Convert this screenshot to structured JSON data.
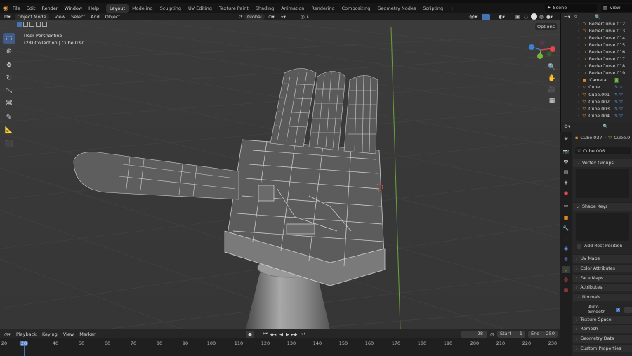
{
  "menubar": {
    "app_menu": [
      "File",
      "Edit",
      "Render",
      "Window",
      "Help"
    ],
    "workspaces": [
      "Layout",
      "Modeling",
      "Sculpting",
      "UV Editing",
      "Texture Paint",
      "Shading",
      "Animation",
      "Rendering",
      "Compositing",
      "Geometry Nodes",
      "Scripting"
    ],
    "active_workspace": "Layout",
    "add_tab": "+",
    "scene_label": "Scene",
    "view_layer_label": "View"
  },
  "viewport_header": {
    "mode": "Object Mode",
    "menus": [
      "View",
      "Select",
      "Add",
      "Object"
    ],
    "orientation": "Global",
    "options": "Options"
  },
  "viewport": {
    "perspective": "User Perspective",
    "collection_info": "(28) Collection | Cube.037",
    "gizmo": {
      "x": "X",
      "y": "Y",
      "z": "Z"
    }
  },
  "timeline": {
    "menus": [
      "Playback",
      "Keying",
      "View",
      "Marker"
    ],
    "current_frame": "28",
    "start_label": "Start",
    "start_value": "1",
    "end_label": "End",
    "end_value": "250",
    "ruler": [
      "20",
      "28",
      "40",
      "50",
      "60",
      "70",
      "80",
      "90",
      "100",
      "110",
      "120",
      "130",
      "140",
      "150",
      "160",
      "170",
      "180",
      "190",
      "200",
      "210",
      "220",
      "230"
    ]
  },
  "outliner": {
    "items": [
      {
        "name": "BezierCurve.012",
        "type": "curve"
      },
      {
        "name": "BezierCurve.013",
        "type": "curve"
      },
      {
        "name": "BezierCurve.014",
        "type": "curve"
      },
      {
        "name": "BezierCurve.015",
        "type": "curve"
      },
      {
        "name": "BezierCurve.016",
        "type": "curve"
      },
      {
        "name": "BezierCurve.017",
        "type": "curve"
      },
      {
        "name": "BezierCurve.018",
        "type": "curve"
      },
      {
        "name": "BezierCurve.019",
        "type": "curve"
      },
      {
        "name": "Camera",
        "type": "camera"
      },
      {
        "name": "Cube",
        "type": "mesh"
      },
      {
        "name": "Cube.001",
        "type": "mesh"
      },
      {
        "name": "Cube.002",
        "type": "mesh"
      },
      {
        "name": "Cube.003",
        "type": "mesh"
      },
      {
        "name": "Cube.004",
        "type": "mesh"
      }
    ]
  },
  "properties": {
    "object_name": "Cube.037",
    "object_data_short": "Cube.0",
    "mesh_name": "Cube.006",
    "panels": [
      {
        "label": "Vertex Groups",
        "open": true
      },
      {
        "label": "Shape Keys",
        "open": true
      },
      {
        "label": "UV Maps",
        "open": false
      },
      {
        "label": "Color Attributes",
        "open": false
      },
      {
        "label": "Face Maps",
        "open": false
      },
      {
        "label": "Attributes",
        "open": false
      },
      {
        "label": "Normals",
        "open": true
      },
      {
        "label": "Texture Space",
        "open": false
      },
      {
        "label": "Remesh",
        "open": false
      },
      {
        "label": "Geometry Data",
        "open": false
      },
      {
        "label": "Custom Properties",
        "open": false
      }
    ],
    "add_rest_position": "Add Rest Position",
    "auto_smooth": "Auto Smooth"
  },
  "colors": {
    "accent_blue": "#4772b3",
    "x_axis": "#e0474e",
    "y_axis": "#7ab33a",
    "z_axis": "#3f7fd6",
    "curve_orange": "#e0892c",
    "mesh_green": "#74c94b"
  }
}
